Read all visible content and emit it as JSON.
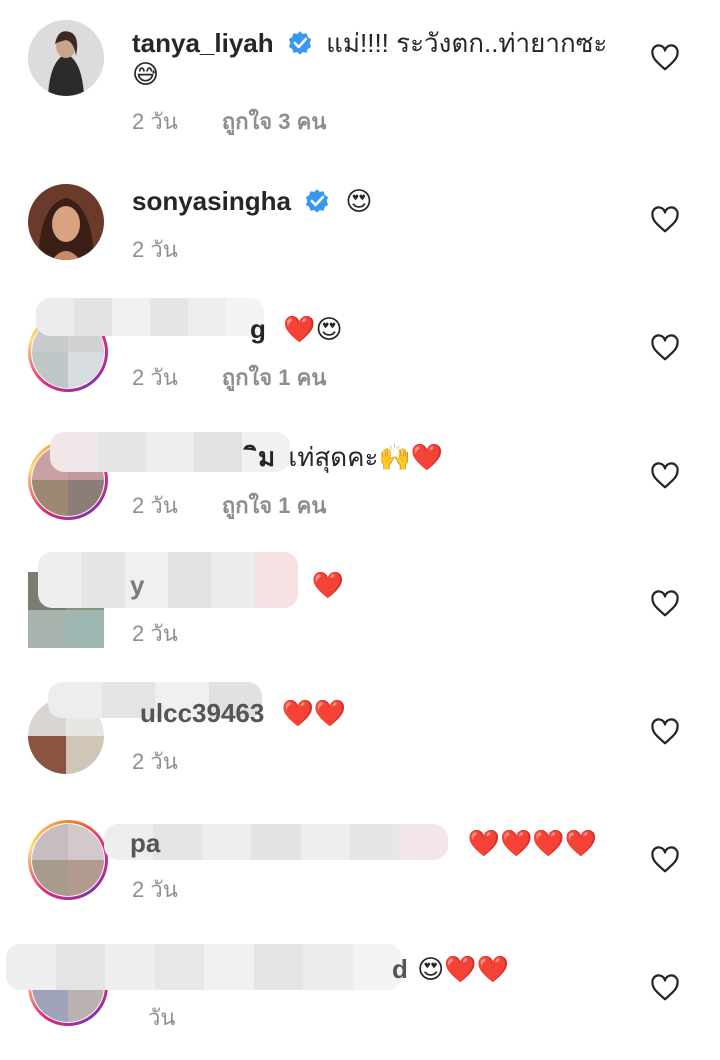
{
  "comments": [
    {
      "username": "tanya_liyah",
      "verified": true,
      "text": "แม่!!!! ระวังตก..ท่ายากซะ",
      "text_line2": "😅",
      "time": "2 วัน",
      "likes": "ถูกใจ 3 คน"
    },
    {
      "username": "sonyasingha",
      "verified": true,
      "text": "😍",
      "time": "2 วัน",
      "likes": ""
    },
    {
      "username_visible_fragment": "g",
      "text": "❤️😍",
      "time": "2 วัน",
      "likes": "ถูกใจ 1 คน"
    },
    {
      "username_visible_fragment": "ิม",
      "text": "เท่สุดคะ🙌❤️",
      "time": "2 วัน",
      "likes": "ถูกใจ 1 คน"
    },
    {
      "username_visible_fragment": "y",
      "text": "❤️",
      "time": "2 วัน",
      "likes": ""
    },
    {
      "username_visible_fragment": "ulcc39463",
      "text": "❤️❤️",
      "time": "2 วัน",
      "likes": ""
    },
    {
      "username_visible_fragment": "pa",
      "text": "❤️❤️❤️❤️",
      "time": "2 วัน",
      "likes": ""
    },
    {
      "username_visible_fragment": "d",
      "text": "😍❤️❤️",
      "time": "วัน",
      "likes": ""
    }
  ],
  "icons": {
    "verified": "verified-badge-icon",
    "like": "heart-outline-icon"
  },
  "colors": {
    "verified_blue": "#3897f0",
    "meta_gray": "#8e8e8e",
    "text": "#262626"
  }
}
